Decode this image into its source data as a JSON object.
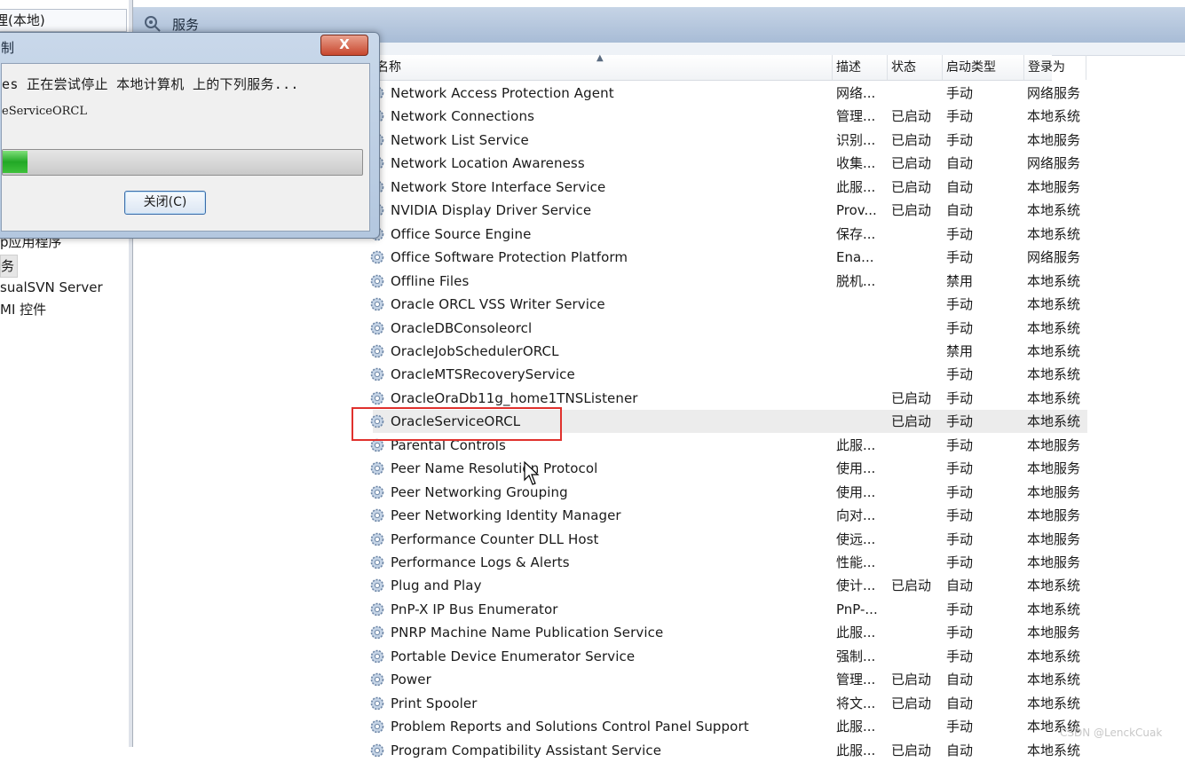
{
  "left_pane": {
    "tree_top": "理(本地)",
    "items": [
      {
        "label": "p应用程序",
        "selected": false
      },
      {
        "label": "务",
        "selected": true
      },
      {
        "label": "sualSVN Server",
        "selected": false
      },
      {
        "label": "MI 控件",
        "selected": false
      }
    ]
  },
  "header": {
    "title": "服务",
    "icon": "gear-search-icon"
  },
  "table": {
    "columns": {
      "name": "名称",
      "desc": "描述",
      "status": "状态",
      "startup": "启动类型",
      "logon": "登录为"
    },
    "rows": [
      {
        "name": "Network Access Protection Agent",
        "desc": "网络...",
        "status": "",
        "startup": "手动",
        "logon": "网络服务"
      },
      {
        "name": "Network Connections",
        "desc": "管理...",
        "status": "已启动",
        "startup": "手动",
        "logon": "本地系统"
      },
      {
        "name": "Network List Service",
        "desc": "识别...",
        "status": "已启动",
        "startup": "手动",
        "logon": "本地服务"
      },
      {
        "name": "Network Location Awareness",
        "desc": "收集...",
        "status": "已启动",
        "startup": "自动",
        "logon": "网络服务"
      },
      {
        "name": "Network Store Interface Service",
        "desc": "此服...",
        "status": "已启动",
        "startup": "自动",
        "logon": "本地服务"
      },
      {
        "name": "NVIDIA Display Driver Service",
        "desc": "Prov...",
        "status": "已启动",
        "startup": "自动",
        "logon": "本地系统"
      },
      {
        "name": "Office  Source Engine",
        "desc": "保存...",
        "status": "",
        "startup": "手动",
        "logon": "本地系统"
      },
      {
        "name": "Office Software Protection Platform",
        "desc": "Ena...",
        "status": "",
        "startup": "手动",
        "logon": "网络服务"
      },
      {
        "name": "Offline Files",
        "desc": "脱机...",
        "status": "",
        "startup": "禁用",
        "logon": "本地系统"
      },
      {
        "name": "Oracle ORCL VSS Writer Service",
        "desc": "",
        "status": "",
        "startup": "手动",
        "logon": "本地系统"
      },
      {
        "name": "OracleDBConsoleorcl",
        "desc": "",
        "status": "",
        "startup": "手动",
        "logon": "本地系统"
      },
      {
        "name": "OracleJobSchedulerORCL",
        "desc": "",
        "status": "",
        "startup": "禁用",
        "logon": "本地系统"
      },
      {
        "name": "OracleMTSRecoveryService",
        "desc": "",
        "status": "",
        "startup": "手动",
        "logon": "本地系统"
      },
      {
        "name": "OracleOraDb11g_home1TNSListener",
        "desc": "",
        "status": "已启动",
        "startup": "手动",
        "logon": "本地系统"
      },
      {
        "name": "OracleServiceORCL",
        "desc": "",
        "status": "已启动",
        "startup": "手动",
        "logon": "本地系统",
        "highlighted": true
      },
      {
        "name": "Parental Controls",
        "desc": "此服...",
        "status": "",
        "startup": "手动",
        "logon": "本地服务"
      },
      {
        "name": "Peer Name Resolution Protocol",
        "desc": "使用...",
        "status": "",
        "startup": "手动",
        "logon": "本地服务"
      },
      {
        "name": "Peer Networking Grouping",
        "desc": "使用...",
        "status": "",
        "startup": "手动",
        "logon": "本地服务"
      },
      {
        "name": "Peer Networking Identity Manager",
        "desc": "向对...",
        "status": "",
        "startup": "手动",
        "logon": "本地服务"
      },
      {
        "name": "Performance Counter DLL Host",
        "desc": "使远...",
        "status": "",
        "startup": "手动",
        "logon": "本地服务"
      },
      {
        "name": "Performance Logs & Alerts",
        "desc": "性能...",
        "status": "",
        "startup": "手动",
        "logon": "本地服务"
      },
      {
        "name": "Plug and Play",
        "desc": "使计...",
        "status": "已启动",
        "startup": "自动",
        "logon": "本地系统"
      },
      {
        "name": "PnP-X IP Bus Enumerator",
        "desc": "PnP-...",
        "status": "",
        "startup": "手动",
        "logon": "本地系统"
      },
      {
        "name": "PNRP Machine Name Publication Service",
        "desc": "此服...",
        "status": "",
        "startup": "手动",
        "logon": "本地服务"
      },
      {
        "name": "Portable Device Enumerator Service",
        "desc": "强制...",
        "status": "",
        "startup": "手动",
        "logon": "本地系统"
      },
      {
        "name": "Power",
        "desc": "管理...",
        "status": "已启动",
        "startup": "自动",
        "logon": "本地系统"
      },
      {
        "name": "Print Spooler",
        "desc": "将文...",
        "status": "已启动",
        "startup": "自动",
        "logon": "本地系统"
      },
      {
        "name": "Problem Reports and Solutions Control Panel Support",
        "desc": "此服...",
        "status": "",
        "startup": "手动",
        "logon": "本地系统"
      },
      {
        "name": "Program Compatibility Assistant Service",
        "desc": "此服...",
        "status": "已启动",
        "startup": "自动",
        "logon": "本地系统"
      }
    ]
  },
  "dialog": {
    "title": "制",
    "close_label": "X",
    "message": "es 正在尝试停止 本地计算机 上的下列服务...",
    "service": "eServiceORCL",
    "progress": 0.07,
    "close_button": "关闭(C)"
  },
  "colors": {
    "highlight_box": "#e0312d",
    "progress_fill": "#22a826",
    "header_bg": "#a8bcd6"
  },
  "watermark": "CSDN @LenckCuak"
}
